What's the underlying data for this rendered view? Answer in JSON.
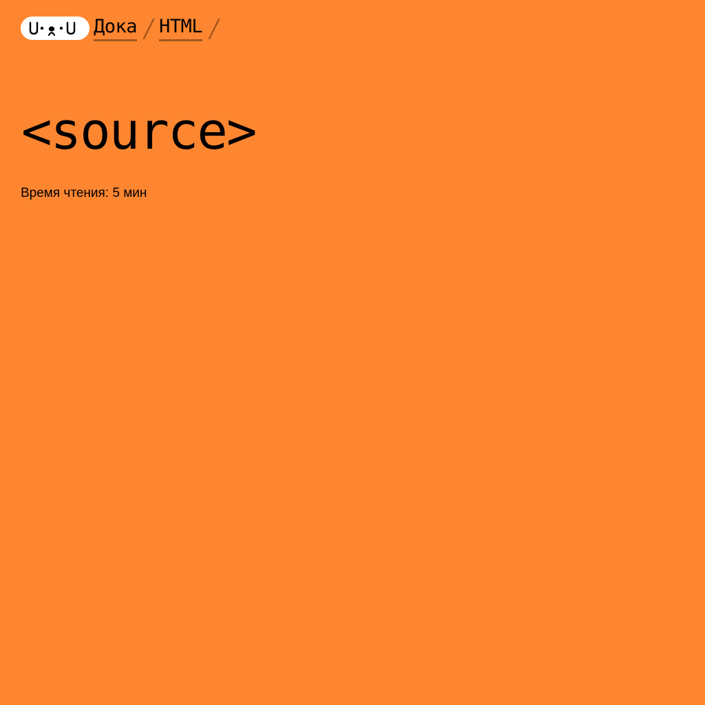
{
  "logo": {
    "icon": "dog-face-logo-icon",
    "text": "U•ᴥ•U"
  },
  "breadcrumbs": {
    "items": [
      {
        "label": "Дока"
      },
      {
        "label": "HTML"
      }
    ],
    "separator_icon": "slash-separator-icon"
  },
  "article": {
    "title": "<source>",
    "reading_time": "Время чтения: 5 мин"
  },
  "colors": {
    "background": "#ff8630",
    "logo_background": "#ffffff",
    "link_underline": "#a3561d",
    "text": "#000000"
  }
}
